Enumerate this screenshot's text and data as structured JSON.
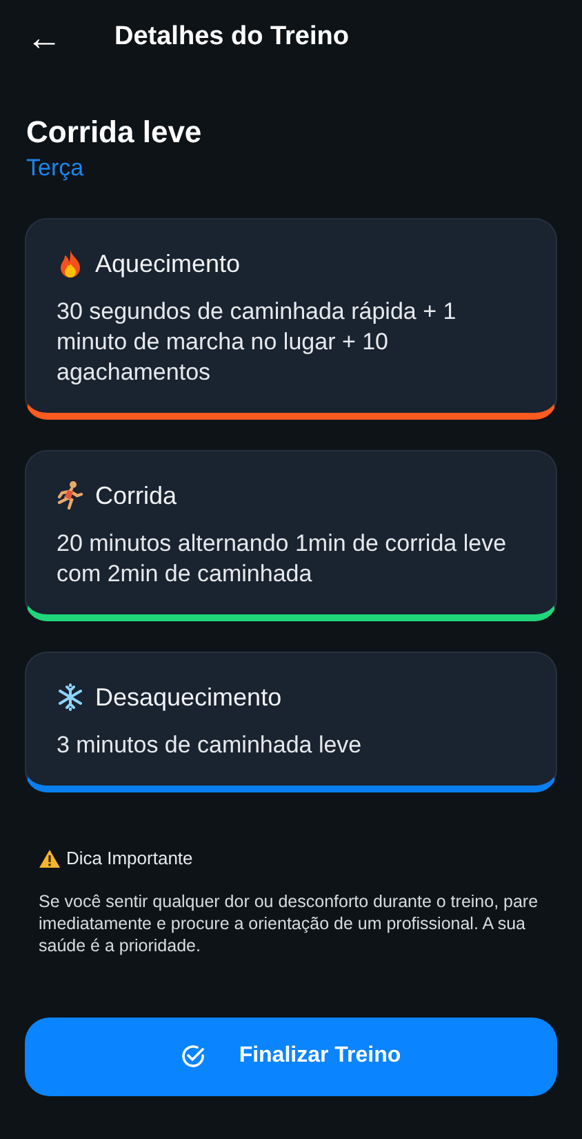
{
  "header": {
    "back": "←",
    "title": "Detalhes do Treino"
  },
  "workout": {
    "name": "Corrida leve",
    "day": "Terça"
  },
  "phases": [
    {
      "kind": "fire",
      "title": "Aquecimento",
      "text": "30 segundos de caminhada rápida + 1 minuto de marcha no lugar + 10 agachamentos",
      "color": "#ff5a1f"
    },
    {
      "kind": "run",
      "title": "Corrida",
      "text": "20 minutos alternando 1min de corrida leve com 2min de caminhada",
      "color": "#1fd67a"
    },
    {
      "kind": "snow",
      "title": "Desaquecimento",
      "text": "3 minutos de caminhada leve",
      "color": "#0a7ff0"
    }
  ],
  "tip": {
    "title": "Dica Importante",
    "text": "Se você sentir qualquer dor ou desconforto durante o treino, pare imediatamente e procure a orientação de um profissional. A sua saúde é a prioridade."
  },
  "finish_button": "Finalizar Treino"
}
